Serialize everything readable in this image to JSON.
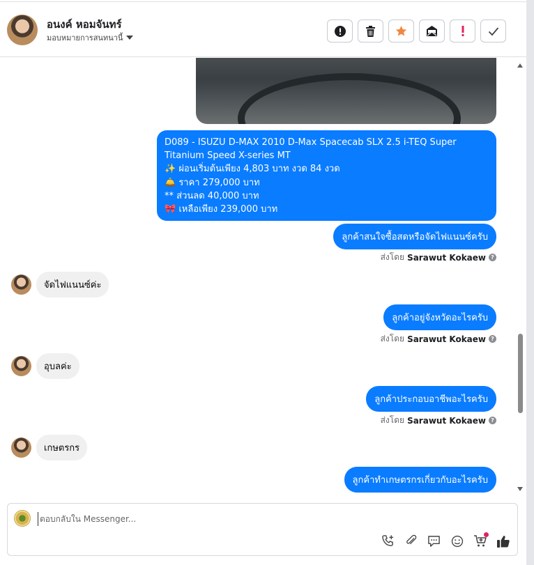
{
  "header": {
    "contact_name": "อนงค์ หอมจันทร์",
    "assign_label": "มอบหมายการสนทนานี้"
  },
  "messages": {
    "product_lines": [
      "D089 - ISUZU D-MAX 2010 D-Max Spacecab SLX 2.5 i-TEQ Super",
      "Titanium Speed X-series MT",
      "✨ ผ่อนเริ่มต้นเพียง 4,803 บาท งวด 84 งวด",
      "🛎️ ราคา 279,000 บาท",
      "** ส่วนลด 40,000 บาท",
      "🎀 เหลือเพียง 239,000 บาท"
    ],
    "out1": "ลูกค้าสนใจซื้อสดหรือจัดไฟแนนซ์ครับ",
    "in1": "จัดไฟแนนซ์ค่ะ",
    "out2": "ลูกค้าอยู่จังหวัดอะไรครับ",
    "in2": "อุบลค่ะ",
    "out3": "ลูกค้าประกอบอาชีพอะไรครับ",
    "in3": "เกษตรกร",
    "out4": "ลูกค้าทำเกษตรกรเกี่ยวกับอะไรครับ",
    "sent_by_prefix": "ส่งโดย",
    "sent_by_name": "Sarawut Kokaew",
    "help_mark": "?"
  },
  "composer": {
    "placeholder": "ตอบกลับใน Messenger..."
  },
  "colors": {
    "outgoing_bubble": "#0a7cff",
    "incoming_bubble": "#f0f0f0",
    "star_accent": "#f0883e",
    "alert_red": "#e0245e"
  },
  "icons": {
    "header_actions": [
      "alert-circle-icon",
      "trash-icon",
      "star-icon",
      "envelope-icon",
      "exclamation-icon",
      "checkmark-icon"
    ],
    "composer_tools": [
      "call-add-icon",
      "paperclip-icon",
      "chat-bubble-icon",
      "smiley-icon",
      "cart-add-icon",
      "thumbs-up-icon"
    ]
  }
}
